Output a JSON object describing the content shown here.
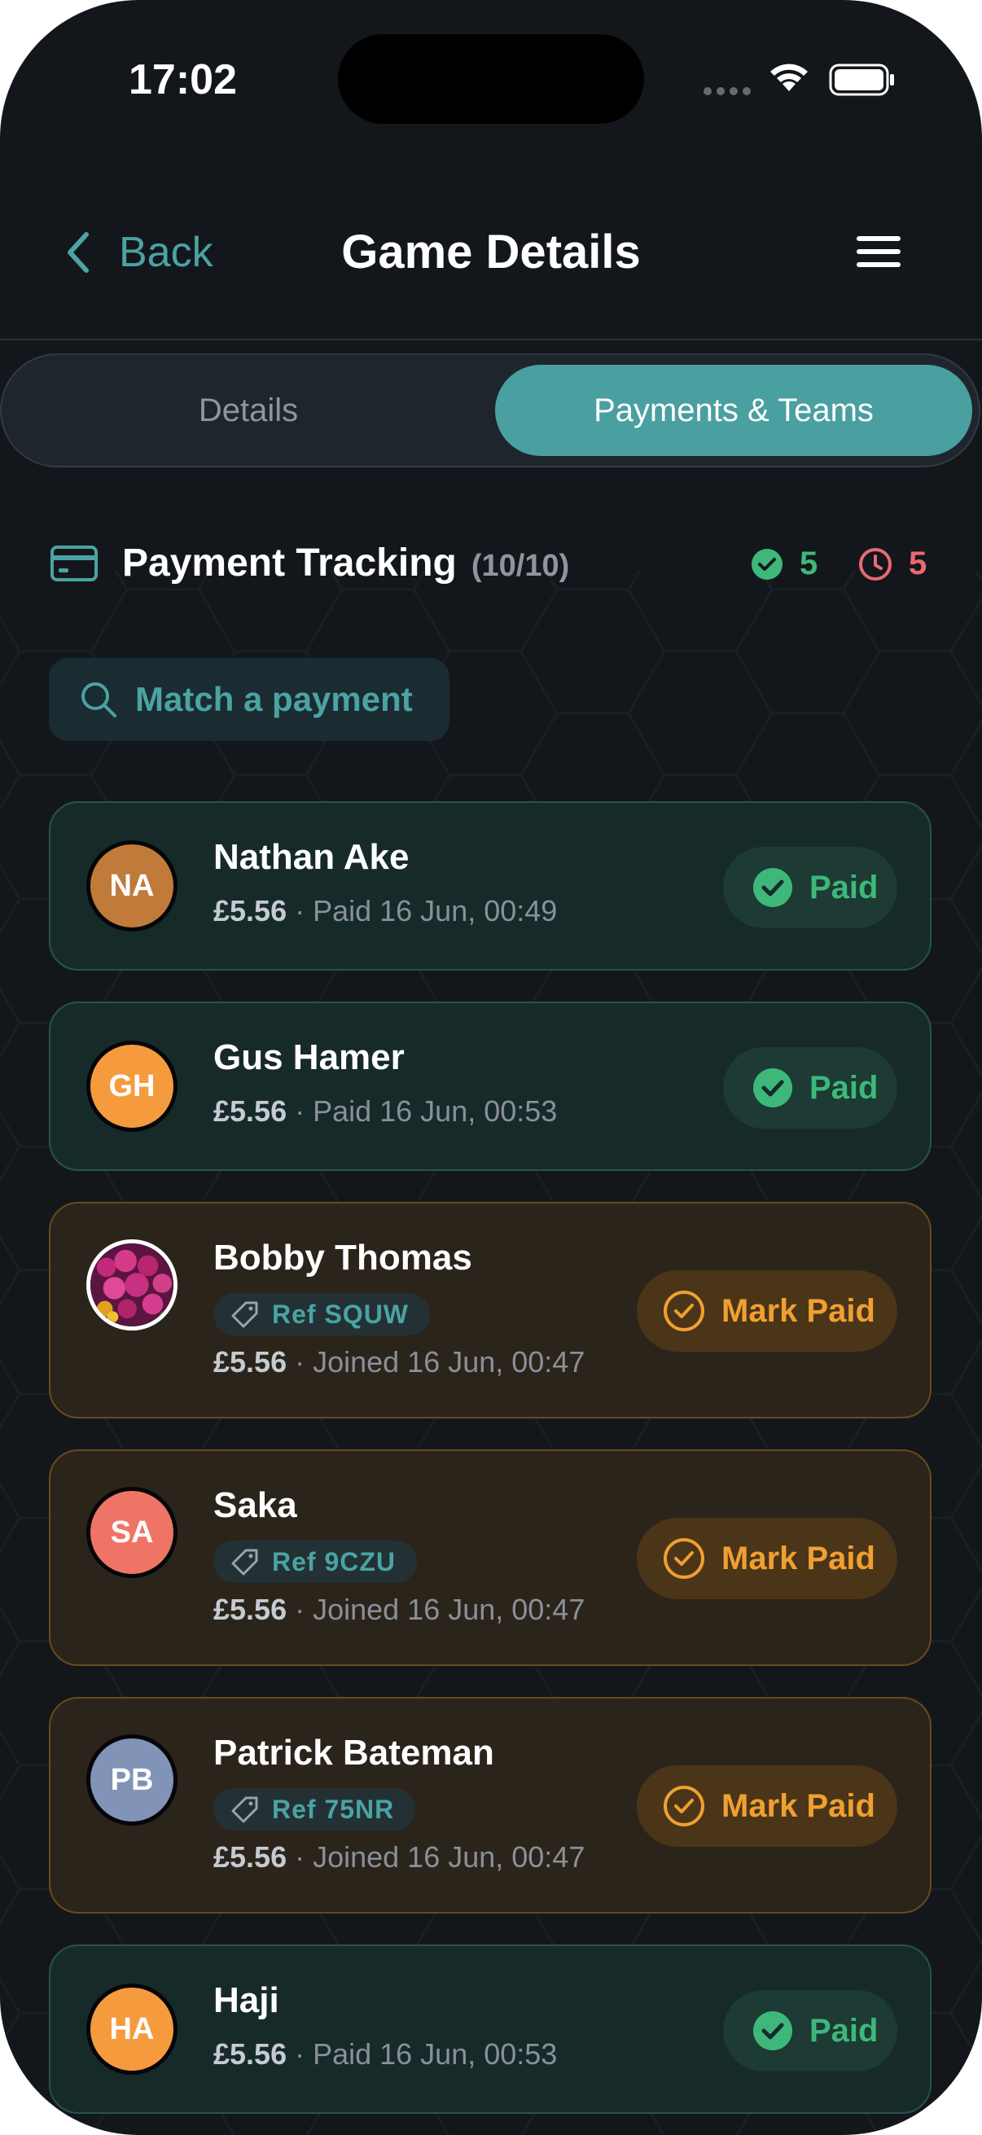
{
  "status_bar": {
    "time": "17:02"
  },
  "header": {
    "back_label": "Back",
    "title": "Game Details"
  },
  "tabs": [
    {
      "label": "Details",
      "selected": false
    },
    {
      "label": "Payments & Teams",
      "selected": true
    }
  ],
  "tracking": {
    "title": "Payment Tracking",
    "count": "(10/10)",
    "paid_count": "5",
    "pending_count": "5"
  },
  "match": {
    "label": "Match a payment"
  },
  "players": [
    {
      "initials": "NA",
      "name": "Nathan Ake",
      "amount": "£5.56",
      "detail": " · Paid 16 Jun, 00:49",
      "status": "Paid",
      "avatar_color": "#c07a3a"
    },
    {
      "initials": "GH",
      "name": "Gus Hamer",
      "amount": "£5.56",
      "detail": " · Paid 16 Jun, 00:53",
      "status": "Paid",
      "avatar_color": "#f59b3e"
    },
    {
      "initials": "",
      "name": "Bobby Thomas",
      "ref": "Ref SQUW",
      "amount": "£5.56",
      "detail": " · Joined 16 Jun, 00:47",
      "status": "Mark Paid",
      "avatar_image": "flowers"
    },
    {
      "initials": "SA",
      "name": "Saka",
      "ref": "Ref 9CZU",
      "amount": "£5.56",
      "detail": " · Joined 16 Jun, 00:47",
      "status": "Mark Paid",
      "avatar_color": "#ee7565"
    },
    {
      "initials": "PB",
      "name": "Patrick Bateman",
      "ref": "Ref 75NR",
      "amount": "£5.56",
      "detail": " · Joined 16 Jun, 00:47",
      "status": "Mark Paid",
      "avatar_color": "#8193b6"
    },
    {
      "initials": "HA",
      "name": "Haji",
      "amount": "£5.56",
      "detail": " · Paid 16 Jun, 00:53",
      "status": "Paid",
      "avatar_color": "#f59b3e"
    }
  ],
  "colors": {
    "accent": "#4a9fa0",
    "paid": "#3db87a",
    "pending": "#e86a6f",
    "mark_paid": "#f0a030",
    "background": "#13171c"
  }
}
